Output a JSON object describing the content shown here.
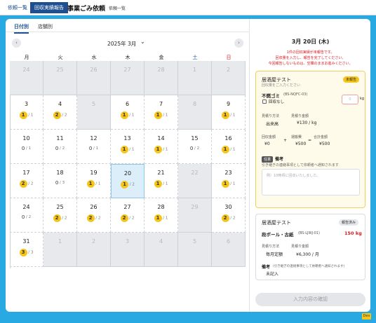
{
  "breadcrumb": {
    "item1": "依頼一覧",
    "active": "回収実績報告",
    "title": "事業ごみ依頼",
    "separator": "›",
    "sub": "依頼一覧"
  },
  "tabs": {
    "by_date": "日付別",
    "by_store": "店舗別"
  },
  "calendar": {
    "month_label": "2025年 3月",
    "weekdays": [
      "月",
      "火",
      "水",
      "木",
      "金",
      "土",
      "日"
    ],
    "weeks": [
      [
        {
          "day": "24",
          "gray": true
        },
        {
          "day": "25",
          "gray": true
        },
        {
          "day": "26",
          "gray": true
        },
        {
          "day": "27",
          "gray": true
        },
        {
          "day": "28",
          "gray": true
        },
        {
          "day": "1",
          "gray": true
        },
        {
          "day": "2",
          "gray": true
        }
      ],
      [
        {
          "day": "3",
          "done": "1",
          "total": "1"
        },
        {
          "day": "4",
          "done": "2",
          "total": "2"
        },
        {
          "day": "5",
          "gray": true
        },
        {
          "day": "6",
          "done": "1",
          "total": "1"
        },
        {
          "day": "7",
          "done": "1",
          "total": "1"
        },
        {
          "day": "8",
          "gray": true
        },
        {
          "day": "9",
          "done": "1",
          "total": "1"
        }
      ],
      [
        {
          "day": "10",
          "done": "0",
          "total": "1"
        },
        {
          "day": "11",
          "done": "0",
          "total": "2"
        },
        {
          "day": "12",
          "done": "0",
          "total": "1"
        },
        {
          "day": "13",
          "done": "1",
          "total": "1"
        },
        {
          "day": "14",
          "done": "1",
          "total": "1"
        },
        {
          "day": "15",
          "done": "0",
          "total": "2"
        },
        {
          "day": "16",
          "done": "1",
          "total": "1"
        }
      ],
      [
        {
          "day": "17",
          "done": "2",
          "total": "2"
        },
        {
          "day": "18",
          "done": "0",
          "total": "3"
        },
        {
          "day": "19",
          "done": "1",
          "total": "1"
        },
        {
          "day": "20",
          "done": "1",
          "total": "2",
          "selected": true
        },
        {
          "day": "21",
          "done": "1",
          "total": "1"
        },
        {
          "day": "22",
          "gray": true
        },
        {
          "day": "23",
          "done": "1",
          "total": "1"
        }
      ],
      [
        {
          "day": "24",
          "done": "0",
          "total": "2"
        },
        {
          "day": "25",
          "done": "2",
          "total": "2"
        },
        {
          "day": "26",
          "done": "2",
          "total": "2"
        },
        {
          "day": "27",
          "done": "2",
          "total": "2"
        },
        {
          "day": "28",
          "done": "1",
          "total": "1"
        },
        {
          "day": "29",
          "gray": true
        },
        {
          "day": "30",
          "done": "2",
          "total": "2"
        }
      ],
      [
        {
          "day": "31",
          "done": "3",
          "total": "3"
        },
        {
          "day": "1",
          "gray": true
        },
        {
          "day": "2",
          "gray": true
        },
        {
          "day": "3",
          "gray": true
        },
        {
          "day": "4",
          "gray": true
        },
        {
          "day": "5",
          "gray": true
        },
        {
          "day": "6",
          "gray": true
        }
      ]
    ]
  },
  "detail": {
    "date": "3月 20日 (木)",
    "warning": [
      "1件の回収実績が未報告です。",
      "回収量を入力し、報告を完了してください。",
      "今回報告しないものは、空欄のままお進みください。"
    ],
    "pending": {
      "store": "居酒屋テスト",
      "status": "未報告",
      "hint": "回収量をご入力ください",
      "waste": "不燃ゴミ",
      "code": "(BS-NQFC-03)",
      "qty_placeholder": "0",
      "unit": "kg",
      "no_collect": "回収なし",
      "method_label": "見積り方法",
      "method": "出来高",
      "price_label": "見積り金額",
      "price": "¥130 / kg",
      "amt_label": "回収金額",
      "amt": "¥0",
      "plus": "+",
      "ship_label": "運搬費",
      "ship": "¥500",
      "eq": "=",
      "total_label": "合計金額",
      "total": "¥500",
      "optional_tag": "任意",
      "note_label": "備考",
      "note_hint": "引き継ぎの連絡事項として依頼者へ通知されます",
      "note_placeholder": "例）10時頃に回収いたしました。"
    },
    "reported": {
      "store": "居酒屋テスト",
      "status": "報告済み",
      "waste": "段ボール・古紙",
      "code": "(BS-LJWJ-01)",
      "amount": "150 kg",
      "method_label": "見積り方法",
      "method": "毎月定額",
      "price_label": "見積り金額",
      "price": "¥6,300 / 月",
      "note_label": "備考",
      "note_hint": "(引き継ぎの連絡事項として依頼者へ通知されます)",
      "note_value": "未記入"
    },
    "submit": "入力内容の確認"
  },
  "dev_badge": "Dev",
  "colors": {
    "brand": "#1d4f91",
    "background": "#29a9e1",
    "badge": "#f5c518",
    "warning": "#d71920",
    "saturday": "#1a56b0",
    "sunday": "#d71920"
  }
}
